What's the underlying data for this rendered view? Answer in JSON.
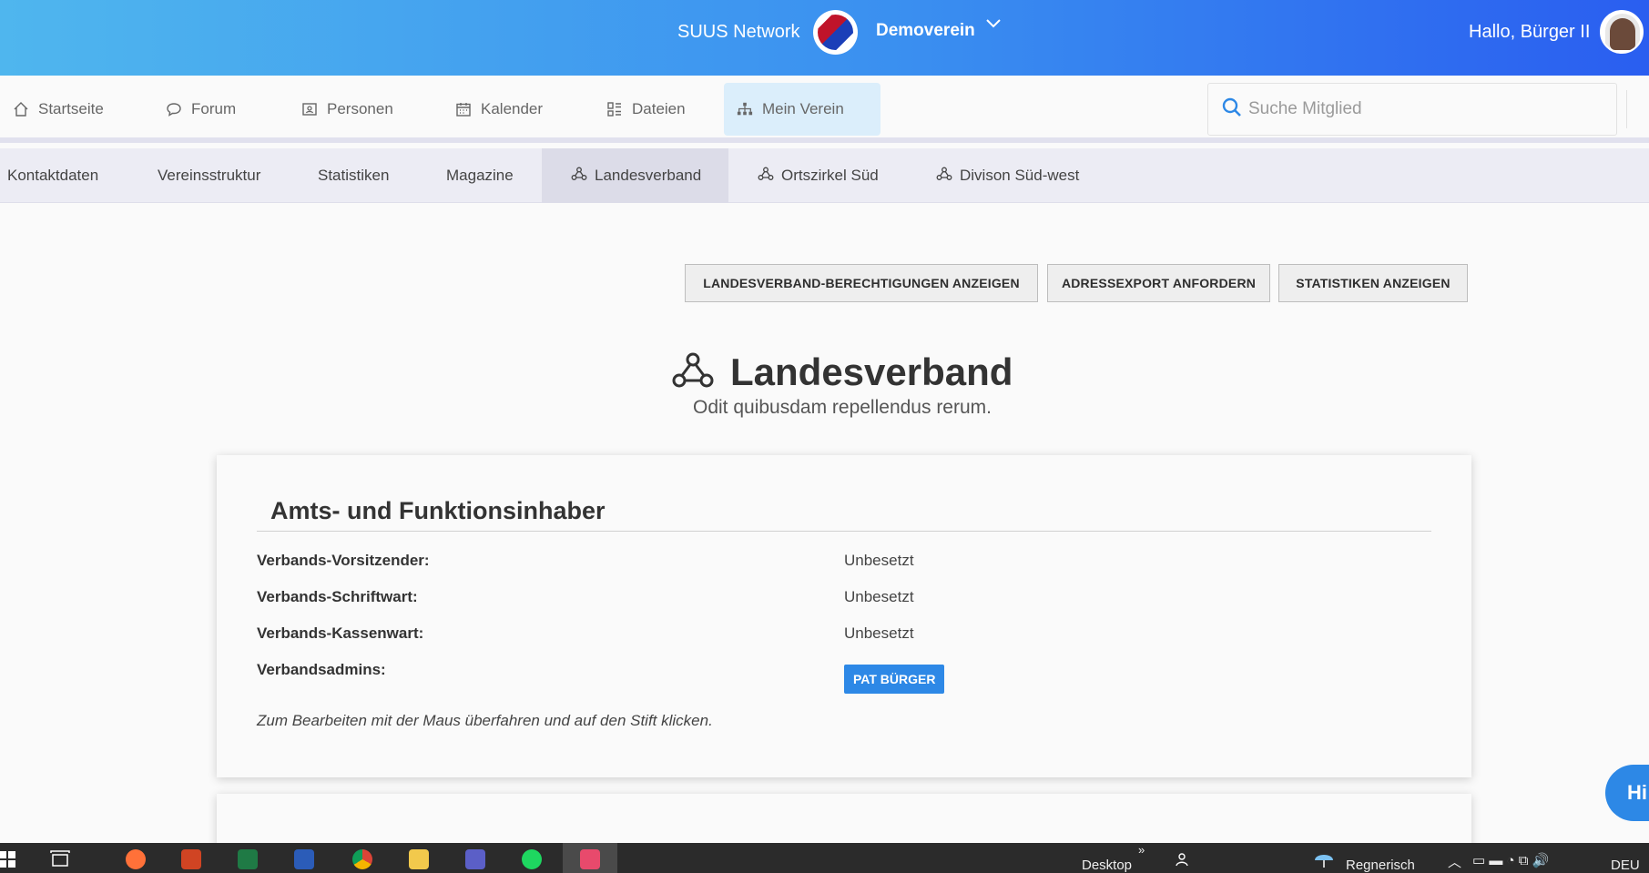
{
  "header": {
    "brand": "SUUS Network",
    "club_name": "Demoverein",
    "greeting": "Hallo, Bürger II"
  },
  "main_nav": {
    "items": [
      {
        "label": "Startseite",
        "icon": "home-icon"
      },
      {
        "label": "Forum",
        "icon": "chat-icon"
      },
      {
        "label": "Personen",
        "icon": "person-card-icon"
      },
      {
        "label": "Kalender",
        "icon": "calendar-icon"
      },
      {
        "label": "Dateien",
        "icon": "files-icon"
      },
      {
        "label": "Mein Verein",
        "icon": "sitemap-icon",
        "active": true
      }
    ],
    "search_placeholder": "Suche Mitglied"
  },
  "sub_nav": {
    "items": [
      {
        "label": "Kontaktdaten"
      },
      {
        "label": "Vereinsstruktur"
      },
      {
        "label": "Statistiken"
      },
      {
        "label": "Magazine"
      },
      {
        "label": "Landesverband",
        "icon": "network-icon",
        "active": true
      },
      {
        "label": "Ortszirkel Süd",
        "icon": "network-icon"
      },
      {
        "label": "Divison Süd-west",
        "icon": "network-icon"
      }
    ]
  },
  "actions": {
    "permissions": "LANDESVERBAND-BERECHTIGUNGEN ANZEIGEN",
    "address_export": "ADRESSEXPORT ANFORDERN",
    "statistics": "STATISTIKEN ANZEIGEN"
  },
  "page": {
    "title": "Landesverband",
    "subtitle": "Odit quibusdam repellendus rerum."
  },
  "officials": {
    "title": "Amts- und Funktionsinhaber",
    "rows": [
      {
        "label": "Verbands-Vorsitzender:",
        "value": "Unbesetzt"
      },
      {
        "label": "Verbands-Schriftwart:",
        "value": "Unbesetzt"
      },
      {
        "label": "Verbands-Kassenwart:",
        "value": "Unbesetzt"
      },
      {
        "label": "Verbandsadmins:",
        "value": "PAT BÜRGER"
      }
    ],
    "hint": "Zum Bearbeiten mit der Maus überfahren und auf den Stift klicken."
  },
  "help": {
    "label": "Hi"
  },
  "taskbar": {
    "desktop_label": "Desktop",
    "weather": "Regnerisch",
    "language": "DEU"
  },
  "colors": {
    "accent": "#2d88e6",
    "header_start": "#4fb6ee",
    "header_end": "#2a5ef0"
  }
}
